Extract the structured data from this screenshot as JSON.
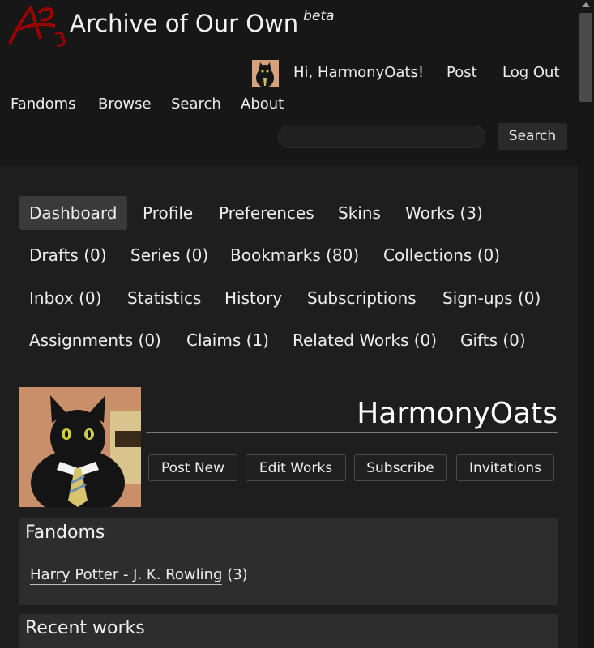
{
  "header": {
    "site_title": "Archive of Our Own",
    "beta_label": "beta",
    "greeting": "Hi, HarmonyOats!",
    "post_label": "Post",
    "logout_label": "Log Out",
    "nav": [
      "Fandoms",
      "Browse",
      "Search",
      "About"
    ],
    "search_value": "",
    "search_button": "Search",
    "logo_color": "#990000"
  },
  "dashboard_nav": {
    "current": "Dashboard",
    "items": [
      "Dashboard",
      "Profile",
      "Preferences",
      "Skins",
      "Works (3)",
      "Drafts (0)",
      "Series (0)",
      "Bookmarks (80)",
      "Collections (0)",
      "Inbox (0)",
      "Statistics",
      "History",
      "Subscriptions",
      "Sign-ups (0)",
      "Assignments (0)",
      "Claims (1)",
      "Related Works (0)",
      "Gifts (0)"
    ]
  },
  "user": {
    "name": "HarmonyOats",
    "actions": [
      "Post New",
      "Edit Works",
      "Subscribe",
      "Invitations"
    ]
  },
  "fandoms_panel": {
    "title": "Fandoms",
    "items": [
      {
        "name": "Harry Potter - J. K. Rowling",
        "count": "(3)"
      }
    ]
  },
  "recent_panel": {
    "title": "Recent works"
  }
}
